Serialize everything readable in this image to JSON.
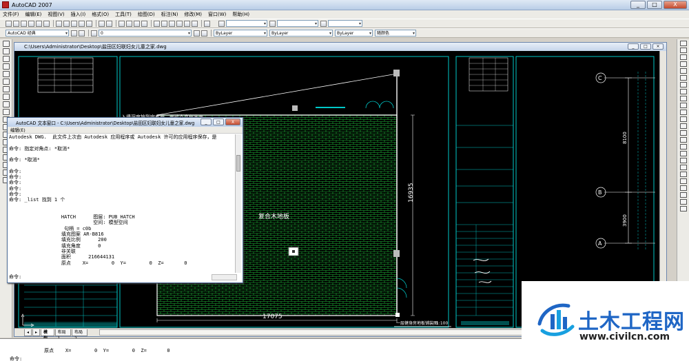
{
  "window": {
    "title": "AutoCAD 2007",
    "min": "_",
    "max": "□",
    "close": "X"
  },
  "menu": [
    "文件(F)",
    "编辑(E)",
    "视图(V)",
    "插入(I)",
    "格式(O)",
    "工具(T)",
    "绘图(D)",
    "标注(N)",
    "修改(M)",
    "窗口(W)",
    "帮助(H)"
  ],
  "toolbar2": {
    "workspace": "AutoCAD 经典",
    "layer": "0",
    "color": "ByLayer",
    "linetype": "ByLayer",
    "lineweight": "ByLayer",
    "plotstyle": "随颜色"
  },
  "drawing": {
    "title": "C:\\Users\\Administrator\\Desktop\\盐田区妇联妇女儿童之家.dwg",
    "room_label": "复合木地板",
    "dim_width": "17075",
    "dim_height": "16935",
    "dim_8100": "8100",
    "dim_3900": "3900",
    "grid_c": "C",
    "grid_b": "B",
    "grid_a": "A",
    "plan_title": "一层健身房地板铺装图",
    "plan_scale": "1:100",
    "note_top": "入墙深度按到完成面，面砂点高程底面"
  },
  "tabs": [
    "模型",
    "布局1",
    "布局2"
  ],
  "textwin": {
    "title": "AutoCAD 文本窗口 - C:\\Users\\Administrator\\Desktop\\盐田区妇联妇女儿童之家.dwg",
    "menu": "编辑(E)",
    "lines": [
      "Autodesk DWG.  此文件上次由 Autodesk 应用程序或 Autodesk 许可的应用程序保存，是",
      "",
      "命令: 指定对角点: *取消*",
      "",
      "命令: *取消*",
      "",
      "命令:",
      "命令:",
      "命令:",
      "命令:",
      "命令:",
      "命令: _list 找到 1 个",
      "",
      "",
      "                  HATCH      图层: PUB_HATCH",
      "                             空间: 模型空间",
      "                   句柄 = c0b",
      "                  填充图案 AR-B816",
      "                  填充比例      200",
      "                  填充角度      0",
      "                  非关联",
      "                  面积      216644131",
      "                  原点    X=        0  Y=        0  Z=       0"
    ],
    "prompt": "命令:"
  },
  "cmdline": {
    "line1": "原点    X=        0  Y=        0  Z=       0",
    "line2": "命令:"
  },
  "watermark": {
    "brand": "土木工程网",
    "url": "www.civilcn.com"
  },
  "colors": {
    "hatch": "#22cc44",
    "frame": "#00c8c8",
    "background": "#000000"
  }
}
